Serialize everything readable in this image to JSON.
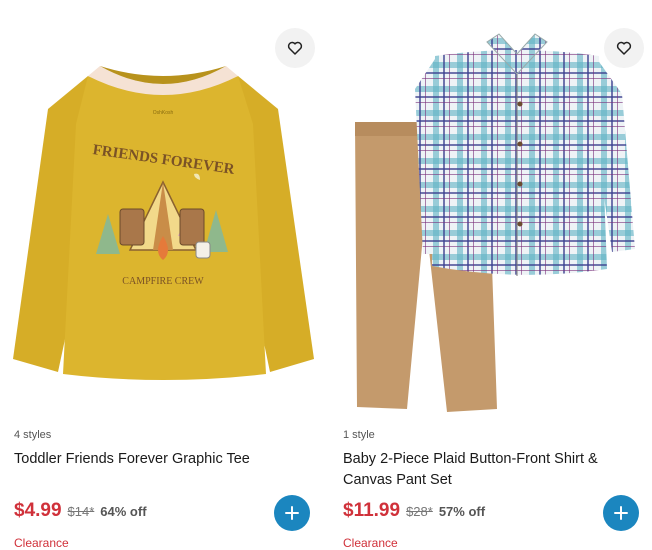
{
  "products": [
    {
      "styles": "4 styles",
      "title": "Toddler Friends Forever Graphic Tee",
      "sale_price": "$4.99",
      "original_price": "$14*",
      "discount": "64% off",
      "tag": "Clearance",
      "graphic_text_top": "FRIENDS FOREVER",
      "graphic_text_bottom": "CAMPFIRE CREW",
      "brand_label": "OshKosh"
    },
    {
      "styles": "1 style",
      "title": "Baby 2-Piece Plaid Button-Front Shirt & Canvas Pant Set",
      "sale_price": "$11.99",
      "original_price": "$28*",
      "discount": "57% off",
      "tag": "Clearance"
    }
  ],
  "colors": {
    "sale": "#d0313a",
    "add_button": "#1b86bf",
    "shirt_mustard": "#d9b22c",
    "pants_tan": "#c49a6c"
  },
  "icons": {
    "favorite": "heart-outline-icon",
    "add": "plus-icon"
  }
}
